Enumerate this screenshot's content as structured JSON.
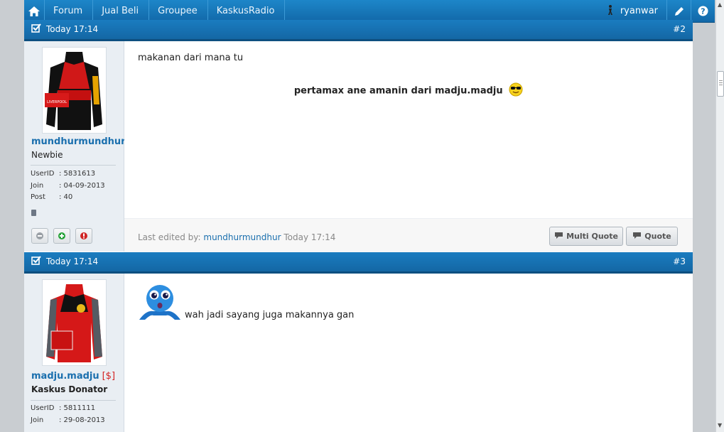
{
  "nav": {
    "items": [
      "Forum",
      "Jual Beli",
      "Groupee",
      "KaskusRadio"
    ],
    "username": "ryanwar"
  },
  "posts": [
    {
      "time": "Today 17:14",
      "number": "#2",
      "username": "mundhurmundhur",
      "rank": "Newbie",
      "userid_label": "UserID",
      "userid": ": 5831613",
      "join_label": "Join",
      "join": ": 04-09-2013",
      "post_label": "Post",
      "post": ": 40",
      "body_line1": "makanan dari mana tu",
      "body_line2": "pertamax ane amanin dari madju.madju",
      "edited_prefix": "Last edited by:",
      "edited_by": "mundhurmundhur",
      "edited_time": "Today 17:14",
      "multi_quote": "Multi Quote",
      "quote": "Quote"
    },
    {
      "time": "Today 17:14",
      "number": "#3",
      "username": "madju.madju",
      "donor_tag": "[$]",
      "rank": "Kaskus Donator",
      "userid_label": "UserID",
      "userid": ": 5811111",
      "join_label": "Join",
      "join": ": 29-08-2013",
      "body_line1": "wah jadi sayang juga makannya gan"
    }
  ],
  "colors": {
    "nav_blue": "#1a7cc0",
    "link_blue": "#1a6fae",
    "donor_red": "#d42020"
  }
}
